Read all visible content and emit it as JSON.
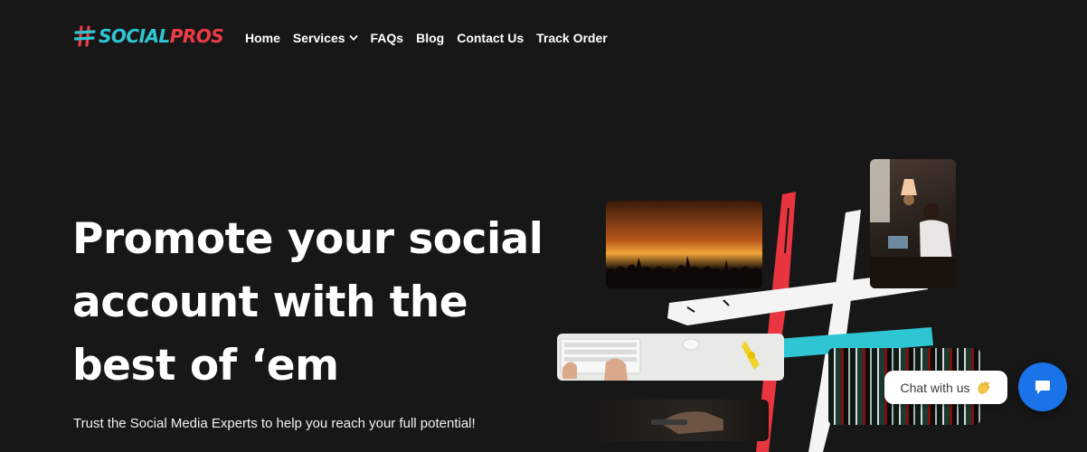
{
  "brand": {
    "name_part1": "SOCIAL",
    "name_part2": "PROS",
    "accent_cyan": "#2fc6d3",
    "accent_red": "#ef3b47"
  },
  "nav": {
    "items": [
      {
        "label": "Home"
      },
      {
        "label": "Services",
        "icon": "chevron-down-icon"
      },
      {
        "label": "FAQs"
      },
      {
        "label": "Blog"
      },
      {
        "label": "Contact Us"
      },
      {
        "label": "Track Order"
      }
    ]
  },
  "hero": {
    "title_line1": "Promote your social",
    "title_line2": "account with the",
    "title_line3": "best of ‘em",
    "subtitle": "Trust the Social Media Experts to help you reach your full potential!"
  },
  "chat": {
    "label": "Chat with us",
    "icon": "waving-hand-icon",
    "button_icon": "chat-bubble-icon",
    "button_color": "#1a73e8"
  },
  "colors": {
    "background": "#171717",
    "text": "#ffffff"
  }
}
